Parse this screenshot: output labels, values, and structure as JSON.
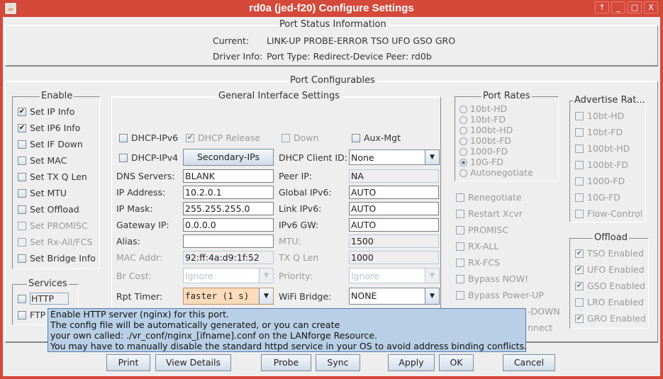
{
  "window": {
    "title": "rd0a  (jed-f20) Configure Settings",
    "controls": [
      "↑",
      "_",
      "□",
      "X"
    ]
  },
  "status": {
    "legend": "Port Status Information",
    "current_label": "Current:",
    "current_value": "LINK-UP PROBE-ERROR TSO UFO GSO GRO",
    "driver_label": "Driver Info:",
    "driver_value": "Port Type: Redirect-Device   Peer: rd0b"
  },
  "configurables": {
    "legend": "Port Configurables"
  },
  "enable": {
    "legend": "Enable",
    "items": [
      {
        "label": "Set IP Info",
        "checked": true,
        "enabled": true
      },
      {
        "label": "Set IP6 Info",
        "checked": true,
        "enabled": true
      },
      {
        "label": "Set IF Down",
        "checked": false,
        "enabled": true
      },
      {
        "label": "Set MAC",
        "checked": false,
        "enabled": true
      },
      {
        "label": "Set TX Q Len",
        "checked": false,
        "enabled": true
      },
      {
        "label": "Set MTU",
        "checked": false,
        "enabled": true
      },
      {
        "label": "Set Offload",
        "checked": false,
        "enabled": true
      },
      {
        "label": "Set PROMISC",
        "checked": false,
        "enabled": false
      },
      {
        "label": "Set Rx-All/FCS",
        "checked": false,
        "enabled": false
      },
      {
        "label": "Set Bridge Info",
        "checked": false,
        "enabled": true
      }
    ]
  },
  "services": {
    "legend": "Services",
    "items": [
      {
        "label": "HTTP",
        "checked": false
      },
      {
        "label": "FTP",
        "checked": false
      }
    ]
  },
  "general": {
    "legend": "General Interface Settings",
    "dhcp_ipv6": "DHCP-IPv6",
    "dhcp_release": "DHCP Release",
    "down": "Down",
    "aux_mgt": "Aux-Mgt",
    "dhcp_ipv4": "DHCP-IPv4",
    "secondary_ips": "Secondary-IPs",
    "dhcp_client_id_label": "DHCP Client ID:",
    "dhcp_client_id_value": "None",
    "dns_label": "DNS Servers:",
    "dns_value": "BLANK",
    "peer_ip_label": "Peer IP:",
    "peer_ip_value": "NA",
    "ip_label": "IP Address:",
    "ip_value": "10.2.0.1",
    "global_ipv6_label": "Global IPv6:",
    "global_ipv6_value": "AUTO",
    "mask_label": "IP Mask:",
    "mask_value": "255.255.255.0",
    "link_ipv6_label": "Link IPv6:",
    "link_ipv6_value": "AUTO",
    "gateway_label": "Gateway IP:",
    "gateway_value": "0.0.0.0",
    "ipv6_gw_label": "IPv6 GW:",
    "ipv6_gw_value": "AUTO",
    "alias_label": "Alias:",
    "alias_value": "",
    "mtu_label": "MTU:",
    "mtu_value": "1500",
    "mac_label": "MAC Addr:",
    "mac_value": "92:ff:4a:d9:1f:52",
    "txq_label": "TX Q Len",
    "txq_value": "1000",
    "br_cost_label": "Br Cost:",
    "br_cost_value": "Ignore",
    "priority_label": "Priority:",
    "priority_value": "Ignore",
    "rpt_timer_label": "Rpt Timer:",
    "rpt_timer_value": "faster  (1 s)",
    "wifi_bridge_label": "WiFi Bridge:",
    "wifi_bridge_value": "NONE"
  },
  "port_rates": {
    "legend": "Port Rates",
    "items": [
      {
        "label": "10bt-HD",
        "selected": false
      },
      {
        "label": "10bt-FD",
        "selected": false
      },
      {
        "label": "100bt-HD",
        "selected": false
      },
      {
        "label": "100bt-FD",
        "selected": false
      },
      {
        "label": "1000-FD",
        "selected": false
      },
      {
        "label": "10G-FD",
        "selected": true
      },
      {
        "label": "Autonegotiate",
        "selected": false
      }
    ]
  },
  "misc_options": [
    "Renegotiate",
    "Restart Xcvr",
    "PROMISC",
    "RX-ALL",
    "RX-FCS",
    "Bypass NOW!",
    "Bypass Power-UP",
    "Bypass Power-DOWN",
    "Disable Bypass Connect"
  ],
  "misc_visible": [
    "Renegotiate",
    "Restart Xcvr",
    "PROMISC",
    "RX-ALL",
    "RX-FCS",
    "Bypass NOW!",
    "Bypass Power-UP",
    "-DOWN",
    "nnect"
  ],
  "advertise": {
    "legend": "Advertise Rat...",
    "items": [
      "10bt-HD",
      "10bt-FD",
      "100bt-HD",
      "100bt-FD",
      "1000-FD",
      "10G-FD",
      "Flow-Control"
    ]
  },
  "offload": {
    "legend": "Offload",
    "items": [
      {
        "label": "TSO Enabled",
        "checked": true
      },
      {
        "label": "UFO Enabled",
        "checked": true
      },
      {
        "label": "GSO Enabled",
        "checked": true
      },
      {
        "label": "LRO Enabled",
        "checked": false
      },
      {
        "label": "GRO Enabled",
        "checked": true
      }
    ]
  },
  "tooltip": {
    "lines": [
      "Enable HTTP server (nginx) for this port.",
      "The config file will be automatically generated, or you can create",
      "your own called: ./vr_conf/nginx_[ifname].conf on the LANforge Resource.",
      "You may have to manually disable the standard httpd service in your OS to avoid address binding conflicts."
    ]
  },
  "buttons": {
    "print": "Print",
    "view_details": "View Details",
    "probe": "Probe",
    "sync": "Sync",
    "apply": "Apply",
    "ok": "OK",
    "cancel": "Cancel"
  },
  "glyphs": {
    "check": "✔",
    "arrow": "▼"
  }
}
